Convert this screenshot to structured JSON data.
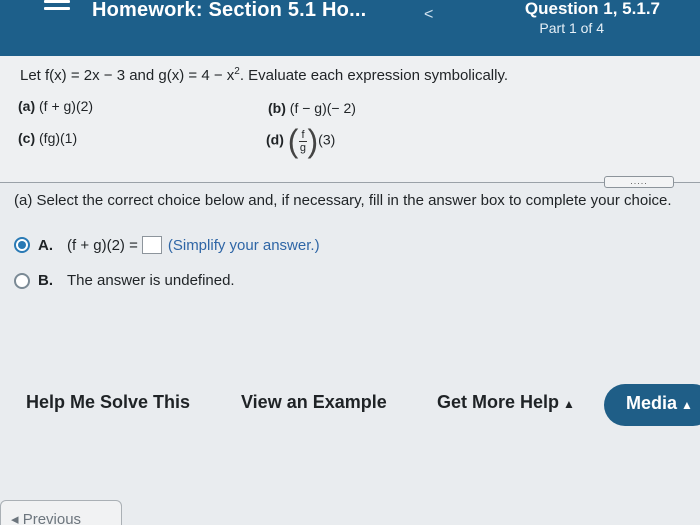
{
  "header": {
    "title": "Homework: Section 5.1 Ho...",
    "question": "Question 1, 5.1.7",
    "part": "Part 1 of 4",
    "back_glyph": "<"
  },
  "problem": {
    "statement_prefix": "Let f(x) = 2x − 3 and g(x) = 4 − x",
    "statement_exp": "2",
    "statement_suffix": ". Evaluate each expression symbolically.",
    "part_a_label": "(a)",
    "part_a_expr": "(f + g)(2)",
    "part_b_label": "(b)",
    "part_b_expr": "(f − g)(− 2)",
    "part_c_label": "(c)",
    "part_c_expr": "(fg)(1)",
    "part_d_label": "(d)",
    "part_d_num": "f",
    "part_d_den": "g",
    "part_d_arg": "(3)"
  },
  "more_dots": ".....",
  "question": {
    "instruction": "(a) Select the correct choice below and, if necessary, fill in the answer box to complete your choice.",
    "choice_a_label": "A.",
    "choice_a_text": "(f + g)(2) =",
    "choice_a_hint": "(Simplify your answer.)",
    "choice_b_label": "B.",
    "choice_b_text": "The answer is undefined.",
    "selected": "A"
  },
  "toolbar": {
    "help_solve": "Help Me Solve This",
    "view_example": "View an Example",
    "more_help": "Get More Help",
    "media": "Media",
    "caret": "▲"
  },
  "nav": {
    "previous": "◂ Previous"
  },
  "colors": {
    "header_bg": "#1d5f8a",
    "accent": "#2a7ab5",
    "hint_text": "#2f66a6"
  }
}
